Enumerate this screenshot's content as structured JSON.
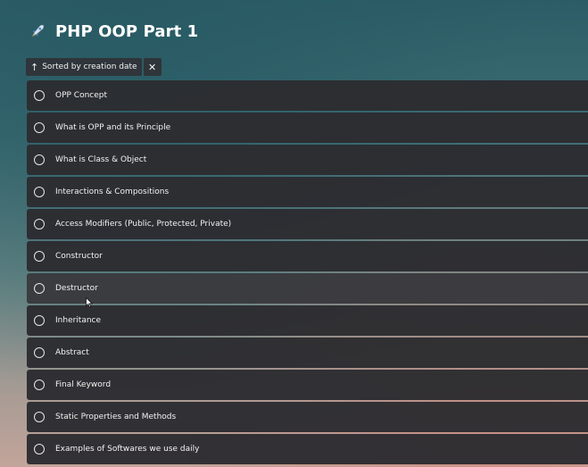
{
  "header": {
    "title": "PHP OOP Part 1",
    "icon": "rocket-icon"
  },
  "sort": {
    "label": "Sorted by creation date",
    "arrow": "↑",
    "close": "✕"
  },
  "tasks": [
    {
      "label": "OPP Concept"
    },
    {
      "label": "What is OPP and its Principle"
    },
    {
      "label": "What is Class & Object"
    },
    {
      "label": "Interactions & Compositions"
    },
    {
      "label": "Access Modifiers (Public, Protected, Private)"
    },
    {
      "label": "Constructor"
    },
    {
      "label": "Destructor"
    },
    {
      "label": "Inheritance"
    },
    {
      "label": "Abstract"
    },
    {
      "label": "Final Keyword"
    },
    {
      "label": "Static Properties and Methods"
    },
    {
      "label": "Examples of Softwares we use daily"
    }
  ]
}
